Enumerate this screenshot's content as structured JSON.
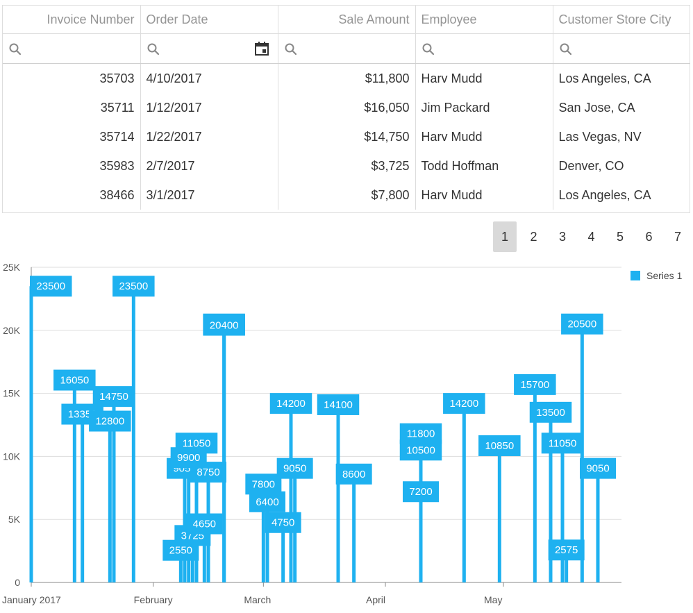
{
  "grid": {
    "columns": [
      "Invoice Number",
      "Order Date",
      "Sale Amount",
      "Employee",
      "Customer Store City"
    ],
    "rows": [
      [
        "35703",
        "4/10/2017",
        "$11,800",
        "Harv Mudd",
        "Los Angeles, CA"
      ],
      [
        "35711",
        "1/12/2017",
        "$16,050",
        "Jim Packard",
        "San Jose, CA"
      ],
      [
        "35714",
        "1/22/2017",
        "$14,750",
        "Harv Mudd",
        "Las Vegas, NV"
      ],
      [
        "35983",
        "2/7/2017",
        "$3,725",
        "Todd Hoffman",
        "Denver, CO"
      ],
      [
        "38466",
        "3/1/2017",
        "$7,800",
        "Harv Mudd",
        "Los Angeles, CA"
      ]
    ]
  },
  "pager": {
    "pages": [
      "1",
      "2",
      "3",
      "4",
      "5",
      "6",
      "7"
    ],
    "active": "1"
  },
  "colors": {
    "series": "#1eb1f0",
    "grid": "#dddddd",
    "axis": "#888888"
  },
  "chart_data": {
    "type": "bar",
    "x_axis_type": "date",
    "x_tick_labels": [
      "January 2017",
      "February",
      "March",
      "April",
      "May"
    ],
    "x_tick_dates": [
      "2017-01-01",
      "2017-02-01",
      "2017-03-01",
      "2017-04-01",
      "2017-05-01"
    ],
    "y_tick_labels": [
      "0",
      "5K",
      "10K",
      "15K",
      "20K",
      "25K"
    ],
    "ylim": [
      0,
      25000
    ],
    "legend_position": "top-right",
    "grid": true,
    "series": [
      {
        "name": "Series 1",
        "points": [
          {
            "x": "2017-01-01",
            "y": 23500,
            "label": "23500"
          },
          {
            "x": "2017-01-12",
            "y": 16050,
            "label": "16050"
          },
          {
            "x": "2017-01-14",
            "y": 13350,
            "label": "13350"
          },
          {
            "x": "2017-01-21",
            "y": 12800,
            "label": "12800"
          },
          {
            "x": "2017-01-22",
            "y": 14750,
            "label": "14750"
          },
          {
            "x": "2017-01-27",
            "y": 23500,
            "label": "23500"
          },
          {
            "x": "2017-02-08",
            "y": 2550,
            "label": "2550"
          },
          {
            "x": "2017-02-09",
            "y": 9050,
            "label": "9050"
          },
          {
            "x": "2017-02-10",
            "y": 9900,
            "label": "9900"
          },
          {
            "x": "2017-02-11",
            "y": 3725,
            "label": "3725"
          },
          {
            "x": "2017-02-12",
            "y": 11050,
            "label": "11050"
          },
          {
            "x": "2017-02-14",
            "y": 4650,
            "label": "4650"
          },
          {
            "x": "2017-02-15",
            "y": 8750,
            "label": "8750"
          },
          {
            "x": "2017-02-19",
            "y": 20500,
            "label": "20500"
          },
          {
            "x": "2017-02-19",
            "y": 20400,
            "label": "20400"
          },
          {
            "x": "2017-03-01",
            "y": 7800,
            "label": "7800"
          },
          {
            "x": "2017-03-02",
            "y": 6400,
            "label": "6400"
          },
          {
            "x": "2017-03-06",
            "y": 4750,
            "label": "4750"
          },
          {
            "x": "2017-03-08",
            "y": 14200,
            "label": "14200"
          },
          {
            "x": "2017-03-09",
            "y": 9050,
            "label": "9050"
          },
          {
            "x": "2017-03-20",
            "y": 14100,
            "label": "14100"
          },
          {
            "x": "2017-03-24",
            "y": 8600,
            "label": "8600"
          },
          {
            "x": "2017-04-10",
            "y": 11800,
            "label": "11800"
          },
          {
            "x": "2017-04-10",
            "y": 10500,
            "label": "10500"
          },
          {
            "x": "2017-04-10",
            "y": 7200,
            "label": "7200"
          },
          {
            "x": "2017-04-21",
            "y": 14200,
            "label": "14200"
          },
          {
            "x": "2017-04-30",
            "y": 10850,
            "label": "10850"
          },
          {
            "x": "2017-05-09",
            "y": 15700,
            "label": "15700"
          },
          {
            "x": "2017-05-13",
            "y": 13500,
            "label": "13500"
          },
          {
            "x": "2017-05-16",
            "y": 11050,
            "label": "11050"
          },
          {
            "x": "2017-05-17",
            "y": 2575,
            "label": "2575"
          },
          {
            "x": "2017-05-21",
            "y": 20500,
            "label": "20500"
          },
          {
            "x": "2017-05-25",
            "y": 9050,
            "label": "9050"
          }
        ]
      }
    ]
  }
}
